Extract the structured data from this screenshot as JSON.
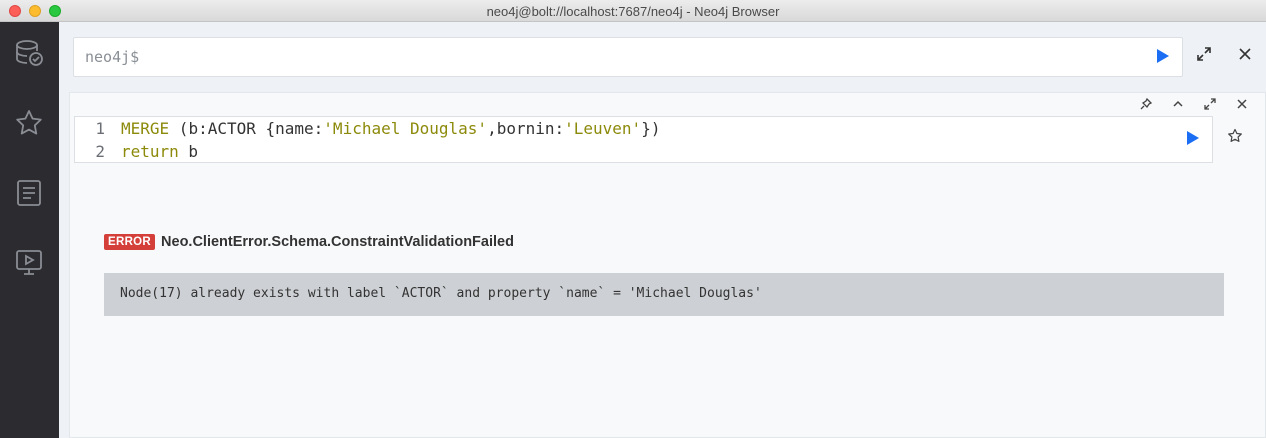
{
  "window": {
    "title": "neo4j@bolt://localhost:7687/neo4j - Neo4j Browser"
  },
  "sidebar": {
    "items": [
      {
        "icon": "database-icon"
      },
      {
        "icon": "star-icon"
      },
      {
        "icon": "document-icon"
      },
      {
        "icon": "monitor-play-icon"
      }
    ]
  },
  "editor": {
    "prompt": "neo4j$"
  },
  "frame": {
    "code": {
      "line1_no": "1",
      "line1_kw": "MERGE",
      "line1_a": " (b:ACTOR {name:",
      "line1_str1": "'Michael Douglas'",
      "line1_b": ",bornin:",
      "line1_str2": "'Leuven'",
      "line1_c": "})",
      "line2_no": "2",
      "line2_kw": "return",
      "line2_a": " b"
    },
    "error": {
      "badge": "ERROR",
      "code": "Neo.ClientError.Schema.ConstraintValidationFailed",
      "message": "Node(17) already exists with label `ACTOR` and property `name` = 'Michael Douglas'"
    }
  },
  "colors": {
    "accent": "#1b6ef3",
    "error": "#d43f3a",
    "sidebar": "#2b2b30"
  }
}
